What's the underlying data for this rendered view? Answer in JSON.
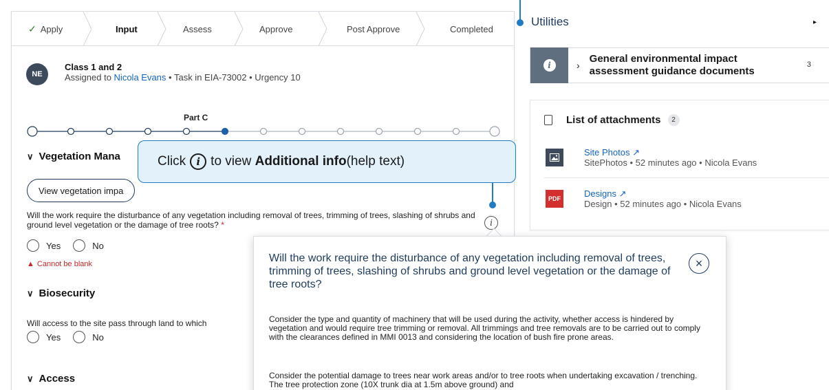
{
  "stepper": {
    "steps": [
      {
        "label": "Apply",
        "state": "done"
      },
      {
        "label": "Input",
        "state": "active"
      },
      {
        "label": "Assess",
        "state": "pending"
      },
      {
        "label": "Approve",
        "state": "pending"
      },
      {
        "label": "Post Approve",
        "state": "pending"
      },
      {
        "label": "Completed",
        "state": "pending"
      }
    ],
    "check_glyph": "✓"
  },
  "task": {
    "avatar_initials": "NE",
    "title": "Class 1 and 2",
    "assigned_prefix": "Assigned to ",
    "assignee": "Nicola Evans",
    "assigned_suffix": " • Task in EIA-73002 • Urgency 10"
  },
  "progress": {
    "part_label": "Part C",
    "total_steps": 13,
    "current_index": 5
  },
  "sections": {
    "vegetation": "Vegetation Mana",
    "biosecurity": "Biosecurity",
    "access": "Access",
    "caret": "∨"
  },
  "view_button": "View vegetation impa",
  "q1": {
    "text": "Will the work require the disturbance of any vegetation including removal of trees, trimming of trees, slashing of shrubs and ground level vegetation or the damage of tree roots?",
    "required": " *",
    "yes": "Yes",
    "no": "No",
    "error_icon": "▲",
    "error": "Cannot be blank"
  },
  "q2": {
    "text": "Will access to the site pass through land to which",
    "yes": "Yes",
    "no": "No"
  },
  "info_glyph": "i",
  "callout": {
    "prefix": "Click ",
    "middle": " to view ",
    "bold": "Additional info",
    "suffix": " (help text)"
  },
  "utilities": {
    "title": "Utilities",
    "caret": "▸"
  },
  "guidance": {
    "chevron": "›",
    "text": "General environmental impact assessment guidance documents",
    "count": "3"
  },
  "attachments": {
    "title": "List of attachments",
    "count": "2",
    "items": [
      {
        "name": "Site Photos",
        "external": "↗",
        "meta": "SitePhotos • 52 minutes ago • Nicola Evans",
        "icon": "image-icon",
        "icon_text": ""
      },
      {
        "name": "Designs",
        "external": "↗",
        "meta": "Design • 52 minutes ago • Nicola Evans",
        "icon": "pdf-icon",
        "icon_text": "PDF"
      }
    ]
  },
  "popover": {
    "title": "Will the work require the disturbance of any vegetation including removal of trees, trimming of trees, slashing of shrubs and ground level vegetation or the damage of tree roots?",
    "close": "×",
    "p1": "Consider the type and quantity of machinery that will be used during the activity, whether access is hindered by vegetation and would require tree trimming or removal. All trimmings and tree removals are to be carried out to comply with the clearances defined in MMI 0013 and considering the location of bush fire prone areas.",
    "p2": "Consider the potential damage to trees near work areas and/or to tree roots when undertaking excavation / trenching. The tree protection zone (10X trunk dia at 1.5m above ground) and"
  },
  "colors": {
    "accent": "#1f7bc4",
    "navy": "#1f3b5c",
    "link": "#1565c0",
    "error": "#c62828",
    "pdf": "#d32f2f"
  }
}
